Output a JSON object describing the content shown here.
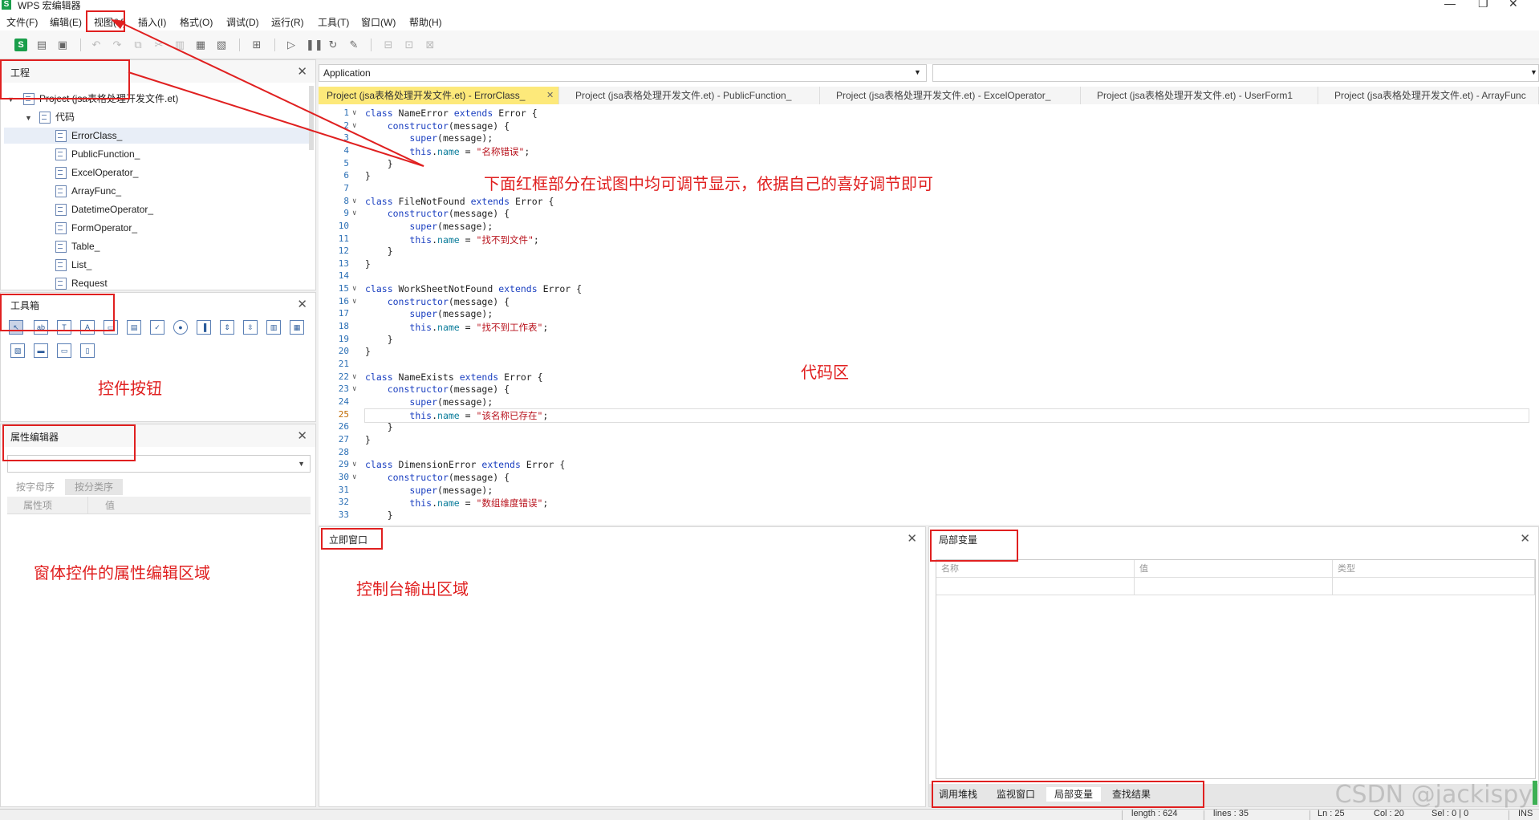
{
  "window": {
    "title": "WPS 宏编辑器",
    "app_icon": "S",
    "minimize": "—",
    "maximize": "❐",
    "close": "✕"
  },
  "menu": [
    "文件(F)",
    "编辑(E)",
    "视图(V)",
    "插入(I)",
    "格式(O)",
    "调试(D)",
    "运行(R)",
    "工具(T)",
    "窗口(W)",
    "帮助(H)"
  ],
  "project_panel": {
    "title": "工程",
    "root": "Project (jsa表格处理开发文件.et)",
    "folder": "代码",
    "items": [
      "ErrorClass_",
      "PublicFunction_",
      "ExcelOperator_",
      "ArrayFunc_",
      "DatetimeOperator_",
      "FormOperator_",
      "Table_",
      "List_",
      "Request"
    ]
  },
  "toolbox_panel": {
    "title": "工具箱"
  },
  "property_panel": {
    "title": "属性编辑器",
    "tabs": [
      "按字母序",
      "按分类序"
    ],
    "columns": [
      "属性项",
      "值"
    ]
  },
  "editor": {
    "object_combo": "Application",
    "proc_combo": "",
    "tabs": [
      "Project (jsa表格处理开发文件.et) - ErrorClass_",
      "Project (jsa表格处理开发文件.et) - PublicFunction_",
      "Project (jsa表格处理开发文件.et) - ExcelOperator_",
      "Project (jsa表格处理开发文件.et) - UserForm1",
      "Project (jsa表格处理开发文件.et) - ArrayFunc"
    ],
    "code_lines": [
      {
        "n": "1",
        "text": "class NameError extends Error {"
      },
      {
        "n": "2",
        "text": "    constructor(message) {"
      },
      {
        "n": "3",
        "text": "        super(message);"
      },
      {
        "n": "4",
        "text": "        this.name = \"名称错误\";"
      },
      {
        "n": "5",
        "text": "    }"
      },
      {
        "n": "6",
        "text": "}"
      },
      {
        "n": "7",
        "text": ""
      },
      {
        "n": "8",
        "text": "class FileNotFound extends Error {"
      },
      {
        "n": "9",
        "text": "    constructor(message) {"
      },
      {
        "n": "10",
        "text": "        super(message);"
      },
      {
        "n": "11",
        "text": "        this.name = \"找不到文件\";"
      },
      {
        "n": "12",
        "text": "    }"
      },
      {
        "n": "13",
        "text": "}"
      },
      {
        "n": "14",
        "text": ""
      },
      {
        "n": "15",
        "text": "class WorkSheetNotFound extends Error {"
      },
      {
        "n": "16",
        "text": "    constructor(message) {"
      },
      {
        "n": "17",
        "text": "        super(message);"
      },
      {
        "n": "18",
        "text": "        this.name = \"找不到工作表\";"
      },
      {
        "n": "19",
        "text": "    }"
      },
      {
        "n": "20",
        "text": "}"
      },
      {
        "n": "21",
        "text": ""
      },
      {
        "n": "22",
        "text": "class NameExists extends Error {"
      },
      {
        "n": "23",
        "text": "    constructor(message) {"
      },
      {
        "n": "24",
        "text": "        super(message);"
      },
      {
        "n": "25",
        "text": "        this.name = \"该名称已存在\";"
      },
      {
        "n": "26",
        "text": "    }"
      },
      {
        "n": "27",
        "text": "}"
      },
      {
        "n": "28",
        "text": ""
      },
      {
        "n": "29",
        "text": "class DimensionError extends Error {"
      },
      {
        "n": "30",
        "text": "    constructor(message) {"
      },
      {
        "n": "31",
        "text": "        super(message);"
      },
      {
        "n": "32",
        "text": "        this.name = \"数组维度错误\";"
      },
      {
        "n": "33",
        "text": "    }"
      }
    ],
    "current_line": "25"
  },
  "immediate_panel": {
    "title": "立即窗口"
  },
  "locals_panel": {
    "title": "局部变量",
    "columns": [
      "名称",
      "值",
      "类型"
    ],
    "bottom_tabs": [
      "调用堆栈",
      "监视窗口",
      "局部变量",
      "查找结果"
    ],
    "active_tab": "局部变量"
  },
  "annotations": {
    "top": "下面红框部分在试图中均可调节显示，依据自己的喜好调节即可",
    "code_area": "代码区",
    "controls": "控件按钮",
    "properties": "窗体控件的属性编辑区域",
    "console": "控制台输出区域"
  },
  "statusbar": {
    "length": "length : 624",
    "lines": "lines : 35",
    "ln": "Ln : 25",
    "col": "Col : 20",
    "sel": "Sel : 0 | 0",
    "mode": "INS"
  },
  "watermark": "CSDN @jackispy",
  "colors": {
    "annotation_red": "#e02020",
    "active_tab": "#fde97a",
    "keyword": "#1a3fc0",
    "string": "#b8121c",
    "brand_green": "#1a9e4b"
  }
}
